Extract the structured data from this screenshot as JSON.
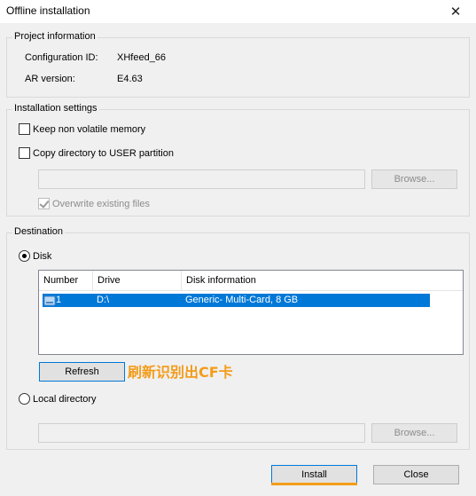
{
  "window": {
    "title": "Offline installation"
  },
  "project_info": {
    "legend": "Project information",
    "config_id_label": "Configuration ID:",
    "config_id_value": "XHfeed_66",
    "ar_version_label": "AR version:",
    "ar_version_value": "E4.63"
  },
  "install_settings": {
    "legend": "Installation settings",
    "keep_nvm_label": "Keep non volatile memory",
    "keep_nvm_checked": false,
    "copy_dir_label": "Copy directory to USER partition",
    "copy_dir_checked": false,
    "path_value": "",
    "browse_label": "Browse...",
    "overwrite_label": "Overwrite existing files",
    "overwrite_checked": true
  },
  "destination": {
    "legend": "Destination",
    "disk_label": "Disk",
    "disk_selected": true,
    "columns": [
      "Number",
      "Drive",
      "Disk information"
    ],
    "rows": [
      {
        "number": "1",
        "drive": "D:\\",
        "info": "Generic- Multi-Card, 8 GB",
        "selected": true
      }
    ],
    "refresh_label": "Refresh",
    "annotation": "刷新识别出CF卡",
    "local_dir_label": "Local directory",
    "local_dir_selected": false,
    "local_path_value": "",
    "browse_label": "Browse..."
  },
  "footer": {
    "install_label": "Install",
    "close_label": "Close"
  },
  "colors": {
    "selection": "#0078d7",
    "annotation": "#f39c1a",
    "background": "#f0f0f0"
  }
}
